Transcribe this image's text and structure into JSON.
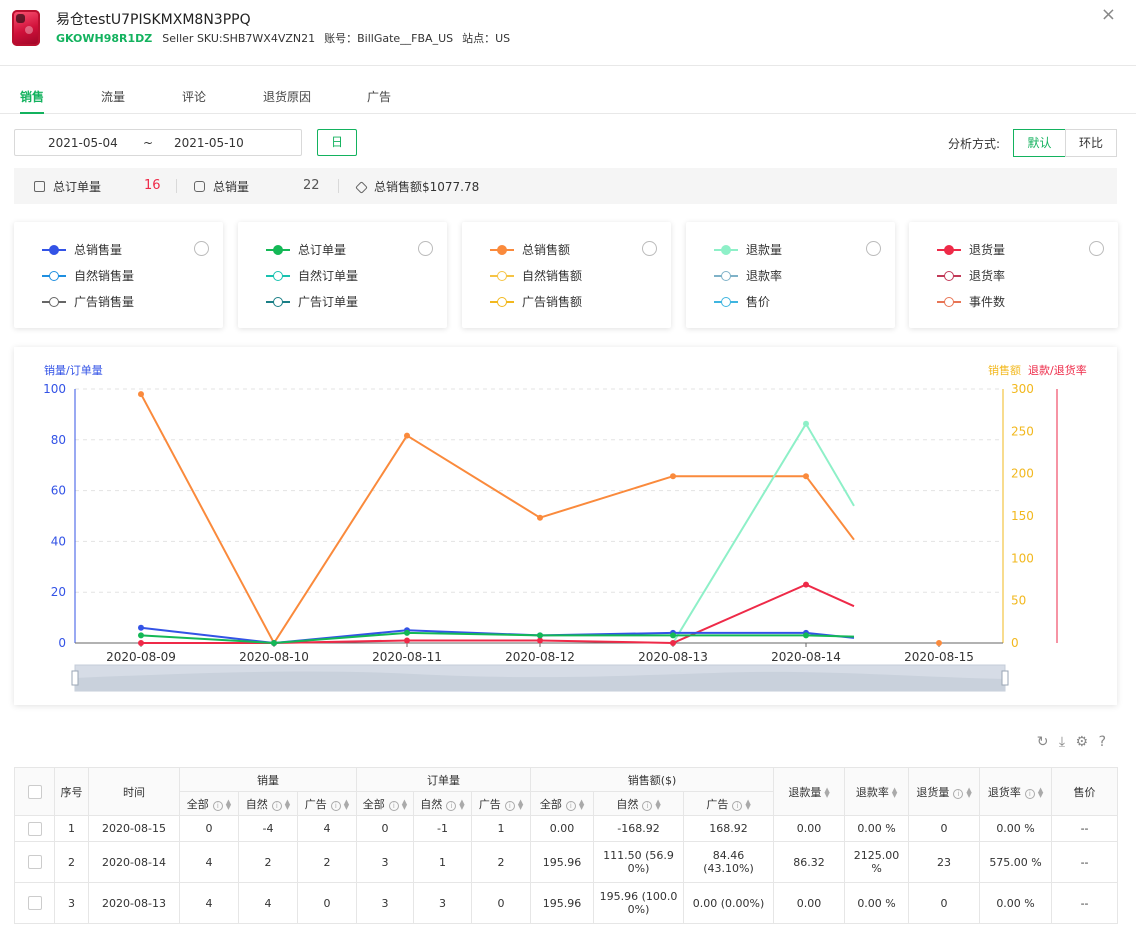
{
  "product": {
    "title": "易仓testU7PISKMXM8N3PPQ",
    "asin": "GKOWH98R1DZ",
    "seller_sku": "Seller SKU:SHB7WX4VZN21",
    "account": "账号：BillGate__FBA_US",
    "site": "站点：US",
    "close_icon": "×"
  },
  "tabs": [
    "销售",
    "流量",
    "评论",
    "退货原因",
    "广告"
  ],
  "toolbar": {
    "start_date": "2021-05-04",
    "sep": "~",
    "end_date": "2021-05-10",
    "granularity": "日",
    "analysis_label": "分析方式:",
    "mode_default": "默认",
    "mode_ring": "环比"
  },
  "summary": {
    "orders_label": "总订单量",
    "orders_value": "16",
    "sales_label": "总销量",
    "sales_value": "22",
    "amount_label": "总销售额$1077.78"
  },
  "legend_cards": [
    {
      "items": [
        {
          "label": "总销售量",
          "color": "#3353e6",
          "filled": true
        },
        {
          "label": "自然销售量",
          "color": "#1f8fe0",
          "filled": false
        },
        {
          "label": "广告销售量",
          "color": "#666666",
          "filled": false
        }
      ]
    },
    {
      "items": [
        {
          "label": "总订单量",
          "color": "#14b856",
          "filled": true
        },
        {
          "label": "自然订单量",
          "color": "#19c2b0",
          "filled": false
        },
        {
          "label": "广告订单量",
          "color": "#1a7f86",
          "filled": false
        }
      ]
    },
    {
      "items": [
        {
          "label": "总销售额",
          "color": "#fa8a3c",
          "filled": true
        },
        {
          "label": "自然销售额",
          "color": "#f6c445",
          "filled": false
        },
        {
          "label": "广告销售额",
          "color": "#f2b81e",
          "filled": false
        }
      ]
    },
    {
      "items": [
        {
          "label": "退款量",
          "color": "#8ef0c8",
          "filled": true
        },
        {
          "label": "退款率",
          "color": "#7fb2c8",
          "filled": false
        },
        {
          "label": "售价",
          "color": "#3fb5e0",
          "filled": false
        }
      ]
    },
    {
      "items": [
        {
          "label": "退货量",
          "color": "#ee2a48",
          "filled": true
        },
        {
          "label": "退货率",
          "color": "#c23a58",
          "filled": false
        },
        {
          "label": "事件数",
          "color": "#e87555",
          "filled": false
        }
      ]
    }
  ],
  "chart_data": {
    "type": "line",
    "left_axis_title": "销量/订单量",
    "right_axis_title_1": "销售额",
    "right_axis_title_2": "退款/退货率",
    "categories": [
      "2020-08-09",
      "2020-08-10",
      "2020-08-11",
      "2020-08-12",
      "2020-08-13",
      "2020-08-14",
      "2020-08-15"
    ],
    "left_ylim": [
      0,
      100
    ],
    "left_ticks": [
      0,
      20,
      40,
      60,
      80,
      100
    ],
    "right_ylim": [
      0,
      300
    ],
    "right_ticks": [
      0,
      50,
      100,
      150,
      200,
      250,
      300
    ],
    "series": [
      {
        "name": "总销售额",
        "axis": "right",
        "color": "#fa8a3c",
        "values": [
          294,
          0,
          245,
          148,
          197,
          197,
          122
        ],
        "last_marker": false,
        "extra_point": [
          6,
          0
        ]
      },
      {
        "name": "退款量",
        "axis": "left",
        "color": "#8ef0c8",
        "values": [
          null,
          null,
          null,
          null,
          0,
          86.3,
          54
        ],
        "last_marker": false
      },
      {
        "name": "退货量",
        "axis": "left",
        "color": "#ee2a48",
        "values": [
          0,
          0,
          1,
          1,
          0,
          23,
          14.5
        ],
        "last_marker": false
      },
      {
        "name": "总销售量",
        "axis": "left",
        "color": "#3353e6",
        "values": [
          6,
          0,
          5,
          3,
          4,
          4,
          2
        ],
        "last_marker": false
      },
      {
        "name": "总订单量",
        "axis": "left",
        "color": "#14b856",
        "values": [
          3,
          0,
          4,
          3,
          3,
          3,
          2.5
        ],
        "last_marker": false
      }
    ]
  },
  "table_tools": {
    "refresh": "↻",
    "download": "⤓",
    "settings": "⚙",
    "help": "?"
  },
  "table": {
    "headers": {
      "index": "序号",
      "time": "时间",
      "sales": "销量",
      "orders": "订单量",
      "amount": "销售额($)",
      "refund_qty": "退款量",
      "refund_rate": "退款率",
      "return_qty": "退货量",
      "return_rate": "退货率",
      "price": "售价",
      "all": "全部",
      "natural": "自然",
      "ad": "广告"
    },
    "rows": [
      {
        "idx": "1",
        "time": "2020-08-15",
        "s_all": "0",
        "s_nat": "-4",
        "s_ad": "4",
        "o_all": "0",
        "o_nat": "-1",
        "o_ad": "1",
        "a_all": "0.00",
        "a_nat": "-168.92",
        "a_ad": "168.92",
        "refund": "0.00",
        "refund_rate": "0.00 %",
        "ret": "0",
        "ret_rate": "0.00 %",
        "price": "--"
      },
      {
        "idx": "2",
        "time": "2020-08-14",
        "s_all": "4",
        "s_nat": "2",
        "s_ad": "2",
        "o_all": "3",
        "o_nat": "1",
        "o_ad": "2",
        "a_all": "195.96",
        "a_nat": "111.50 (56.9 0%)",
        "a_ad": "84.46 (43.10%)",
        "refund": "86.32",
        "refund_rate": "2125.00 %",
        "ret": "23",
        "ret_rate": "575.00 %",
        "price": "--"
      },
      {
        "idx": "3",
        "time": "2020-08-13",
        "s_all": "4",
        "s_nat": "4",
        "s_ad": "0",
        "o_all": "3",
        "o_nat": "3",
        "o_ad": "0",
        "a_all": "195.96",
        "a_nat": "195.96 (100.0 0%)",
        "a_ad": "0.00 (0.00%)",
        "refund": "0.00",
        "refund_rate": "0.00 %",
        "ret": "0",
        "ret_rate": "0.00 %",
        "price": "--"
      }
    ]
  }
}
